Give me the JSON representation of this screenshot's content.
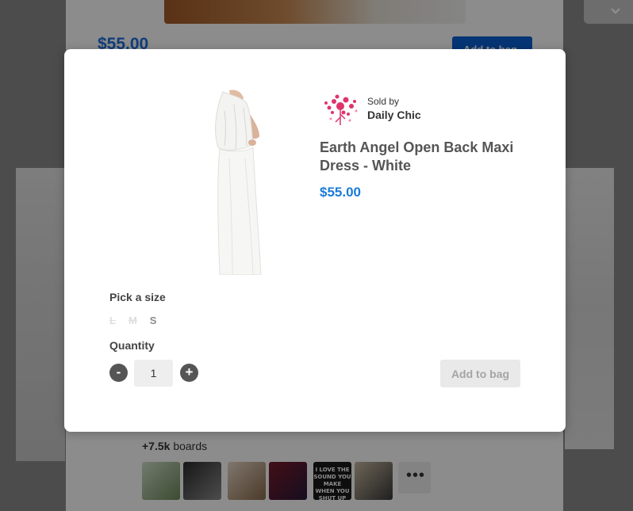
{
  "background": {
    "price": "$55.00",
    "add_to_bag_label": "Add to bag",
    "boards_count": "+7.5k",
    "boards_label": "boards",
    "thumb_text": "I LOVE THE SOUND YOU MAKE WHEN YOU SHUT UP",
    "more_label": "•••"
  },
  "modal": {
    "seller": {
      "sold_by_label": "Sold by",
      "name": "Daily Chic"
    },
    "product": {
      "title": "Earth Angel Open Back Maxi Dress - White",
      "price": "$55.00"
    },
    "size": {
      "label": "Pick a size",
      "options": [
        {
          "label": "L",
          "available": false
        },
        {
          "label": "M",
          "available": false
        },
        {
          "label": "S",
          "available": true
        }
      ]
    },
    "quantity": {
      "label": "Quantity",
      "minus": "-",
      "plus": "+",
      "value": "1"
    },
    "add_to_bag_label": "Add to bag"
  },
  "colors": {
    "price_blue": "#1a7bd9",
    "button_blue": "#0a62d6",
    "logo_pink": "#e0336c"
  }
}
